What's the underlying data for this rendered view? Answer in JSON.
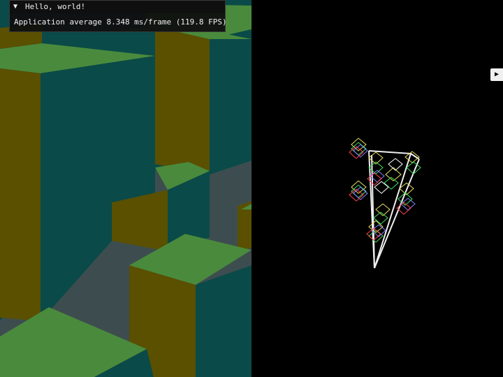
{
  "imgui": {
    "title_icon": "collapse-triangle-icon",
    "title": "Hello, world!",
    "fps_line": "Application average 8.348 ms/frame (119.8 FPS)"
  },
  "right_panel": {
    "toggle_icon": "play-triangle-icon",
    "toggle_glyph": "▶"
  },
  "colors": {
    "top_face": "#4a8a3c",
    "side_olive": "#5a5000",
    "side_teal": "#0a4a48",
    "ground_gray": "#3a4a4a",
    "background": "#000000"
  }
}
